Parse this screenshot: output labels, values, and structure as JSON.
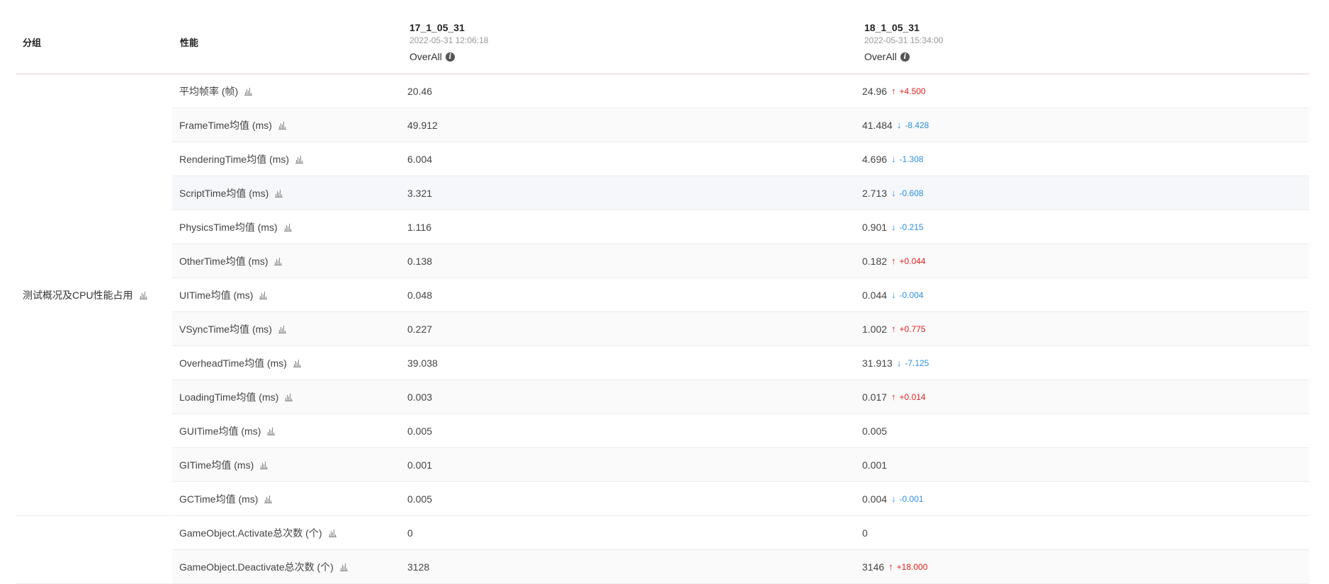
{
  "header": {
    "group_label": "分组",
    "perf_label": "性能",
    "columns": [
      {
        "name": "17_1_05_31",
        "time": "2022-05-31 12:06:18",
        "mode": "OverAll"
      },
      {
        "name": "18_1_05_31",
        "time": "2022-05-31 15:34:00",
        "mode": "OverAll"
      }
    ]
  },
  "groups": [
    {
      "label": "测试概况及CPU性能占用",
      "rows": [
        {
          "metric": "平均帧率 (帧)",
          "v1": "20.46",
          "v2": "24.96",
          "dir": "up",
          "delta": "+4.500"
        },
        {
          "metric": "FrameTime均值 (ms)",
          "v1": "49.912",
          "v2": "41.484",
          "dir": "down",
          "delta": "-8.428"
        },
        {
          "metric": "RenderingTime均值 (ms)",
          "v1": "6.004",
          "v2": "4.696",
          "dir": "down",
          "delta": "-1.308"
        },
        {
          "metric": "ScriptTime均值 (ms)",
          "v1": "3.321",
          "v2": "2.713",
          "dir": "down",
          "delta": "-0.608"
        },
        {
          "metric": "PhysicsTime均值 (ms)",
          "v1": "1.116",
          "v2": "0.901",
          "dir": "down",
          "delta": "-0.215"
        },
        {
          "metric": "OtherTime均值 (ms)",
          "v1": "0.138",
          "v2": "0.182",
          "dir": "up",
          "delta": "+0.044"
        },
        {
          "metric": "UITime均值 (ms)",
          "v1": "0.048",
          "v2": "0.044",
          "dir": "down",
          "delta": "-0.004"
        },
        {
          "metric": "VSyncTime均值 (ms)",
          "v1": "0.227",
          "v2": "1.002",
          "dir": "up",
          "delta": "+0.775"
        },
        {
          "metric": "OverheadTime均值 (ms)",
          "v1": "39.038",
          "v2": "31.913",
          "dir": "down",
          "delta": "-7.125"
        },
        {
          "metric": "LoadingTime均值 (ms)",
          "v1": "0.003",
          "v2": "0.017",
          "dir": "up",
          "delta": "+0.014"
        },
        {
          "metric": "GUITime均值 (ms)",
          "v1": "0.005",
          "v2": "0.005",
          "dir": "",
          "delta": ""
        },
        {
          "metric": "GITime均值 (ms)",
          "v1": "0.001",
          "v2": "0.001",
          "dir": "",
          "delta": ""
        },
        {
          "metric": "GCTime均值 (ms)",
          "v1": "0.005",
          "v2": "0.004",
          "dir": "down",
          "delta": "-0.001"
        }
      ]
    },
    {
      "label": "",
      "rows": [
        {
          "metric": "GameObject.Activate总次数 (个)",
          "v1": "0",
          "v2": "0",
          "dir": "",
          "delta": ""
        },
        {
          "metric": "GameObject.Deactivate总次数 (个)",
          "v1": "3128",
          "v2": "3146",
          "dir": "up",
          "delta": "+18.000"
        }
      ]
    }
  ],
  "icons": {
    "chart": "bar-chart-icon",
    "info": "info-icon",
    "up": "arrow-up-icon",
    "down": "arrow-down-icon"
  },
  "colors": {
    "up": "#e02020",
    "down": "#2f8fe0",
    "header_border": "#f0c9cf"
  }
}
